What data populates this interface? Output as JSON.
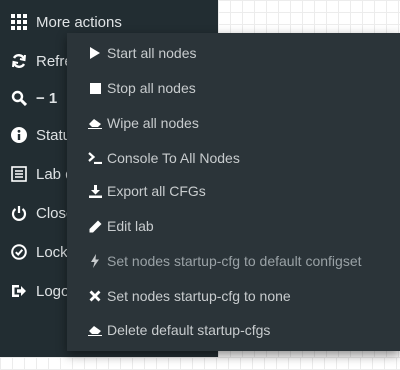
{
  "sidebar": {
    "items": [
      {
        "label": "More actions",
        "icon": "grid-icon"
      },
      {
        "label": "Refresh",
        "icon": "refresh-icon"
      },
      {
        "label": "− 1",
        "icon": "zoom-icon"
      },
      {
        "label": "Status",
        "icon": "info-icon"
      },
      {
        "label": "Lab details",
        "icon": "list-icon"
      },
      {
        "label": "Close lab",
        "icon": "power-icon"
      },
      {
        "label": "Lock lab",
        "icon": "lock-check-icon"
      },
      {
        "label": "Logout",
        "icon": "logout-icon"
      }
    ]
  },
  "menu": {
    "items": [
      {
        "label": "Start all nodes",
        "icon": "play-icon"
      },
      {
        "label": "Stop all nodes",
        "icon": "stop-icon"
      },
      {
        "label": "Wipe all nodes",
        "icon": "eraser-icon"
      },
      {
        "label": "Console To All Nodes",
        "icon": "terminal-icon"
      },
      {
        "label": "Export all CFGs",
        "icon": "download-icon"
      },
      {
        "label": "Edit lab",
        "icon": "pencil-icon"
      },
      {
        "label": "Set nodes startup-cfg to default configset",
        "icon": "bolt-icon"
      },
      {
        "label": "Set nodes startup-cfg to none",
        "icon": "x-icon"
      },
      {
        "label": "Delete default startup-cfgs",
        "icon": "eraser-icon"
      }
    ]
  },
  "colors": {
    "sidebar_bg": "#222d32",
    "menu_bg": "#2b3439",
    "text": "#c8ccce"
  }
}
